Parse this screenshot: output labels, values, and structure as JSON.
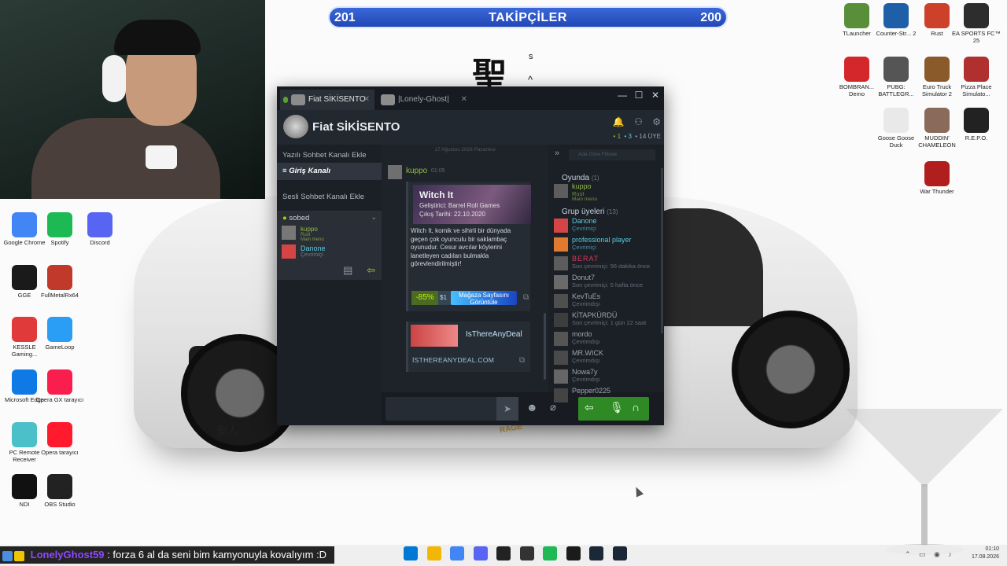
{
  "follower_bar": {
    "current": "201",
    "label": "TAKİPÇİLER",
    "goal": "200",
    "progress": 1.0
  },
  "wallpaper": {
    "kanji_main": "聖",
    "kanji_s": "s",
    "kanji_caret": "^",
    "car_kanji": "聖人",
    "car_badge": "RAGE"
  },
  "desktop_left": [
    {
      "id": "chrome",
      "label": "Google Chrome",
      "color": "#4285f4",
      "icon": "chrome-icon"
    },
    {
      "id": "spotify",
      "label": "Spotify",
      "color": "#1db954",
      "icon": "spotify-icon"
    },
    {
      "id": "discord",
      "label": "Discord",
      "color": "#5865f2",
      "icon": "discord-icon"
    },
    {
      "id": "gg",
      "label": "GGE",
      "color": "#1a1a1a",
      "icon": "power-icon"
    },
    {
      "id": "fw",
      "label": "FullMetalRx64",
      "color": "#c0392b",
      "icon": "flame-icon"
    },
    {
      "id": "kesk",
      "label": "KESSLE Gaming...",
      "color": "#e03a3a",
      "icon": "kessle-icon"
    },
    {
      "id": "gameloop",
      "label": "GameLoop",
      "color": "#2a9df4",
      "icon": "gameloop-icon"
    },
    {
      "id": "edge",
      "label": "Microsoft Edge",
      "color": "#0f7ae5",
      "icon": "edge-icon"
    },
    {
      "id": "operagx",
      "label": "Opera GX tarayıcı",
      "color": "#fa1e4e",
      "icon": "opera-gx-icon"
    },
    {
      "id": "parsec",
      "label": "PC Remote Receiver",
      "color": "#4bc0c8",
      "icon": "remote-icon"
    },
    {
      "id": "opera",
      "label": "Opera tarayıcı",
      "color": "#ff1b2d",
      "icon": "opera-icon"
    },
    {
      "id": "ndi",
      "label": "NDI",
      "color": "#111111",
      "icon": "ndi-icon"
    },
    {
      "id": "obs",
      "label": "OBS Studio",
      "color": "#222222",
      "icon": "obs-icon"
    }
  ],
  "desktop_right": [
    {
      "id": "tlauncher",
      "label": "TLauncher",
      "color": "#5a8f3a",
      "icon": "minecraft-icon"
    },
    {
      "id": "cs2",
      "label": "Counter-Str... 2",
      "color": "#1f5fa8",
      "icon": "cs-icon"
    },
    {
      "id": "rust",
      "label": "Rust",
      "color": "#cd412b",
      "icon": "rust-icon"
    },
    {
      "id": "fc25",
      "label": "EA SPORTS FC™ 25",
      "color": "#2d2d2d",
      "icon": "fc-icon"
    },
    {
      "id": "bomb",
      "label": "BOMBRAN... Demo",
      "color": "#d4272b",
      "icon": "bomb-icon"
    },
    {
      "id": "pubg",
      "label": "PUBG: BATTLEGR...",
      "color": "#555555",
      "icon": "pubg-icon"
    },
    {
      "id": "ets2",
      "label": "Euro Truck Simulator 2",
      "color": "#8b5a2b",
      "icon": "truck-icon"
    },
    {
      "id": "pizza",
      "label": "Pizza Place Simulato...",
      "color": "#b03030",
      "icon": "pizza-icon"
    },
    {
      "id": "goose",
      "label": "Goose Goose Duck",
      "color": "#e9e9e9",
      "icon": "goose-icon"
    },
    {
      "id": "muggame",
      "label": "MUDDIN' CHAMELEON",
      "color": "#8a6a5a",
      "icon": "chameleon-icon"
    },
    {
      "id": "repo",
      "label": "R.E.P.O.",
      "color": "#222222",
      "icon": "repo-icon"
    },
    {
      "id": "warthunder",
      "label": "War Thunder",
      "color": "#b01e1e",
      "icon": "war-thunder-icon"
    }
  ],
  "steam": {
    "tabs": [
      {
        "label": "Fiat SİKİSENTO",
        "active": true
      },
      {
        "label": "|Lonely-Ghost|",
        "active": false
      }
    ],
    "group_name": "Fiat SİKİSENTO",
    "counts": {
      "in_game": "1",
      "online": "3",
      "members": "14 ÜYE"
    },
    "channels": {
      "add_text": "Yazılı Sohbet Kanalı Ekle",
      "entry": "Giriş Kanalı",
      "add_voice": "Sesli Sohbet Kanalı Ekle",
      "voice_name": "sobed",
      "voice_members": [
        {
          "name": "kuppo",
          "status": "Rust",
          "sub": "Main menu",
          "state": "ingame"
        },
        {
          "name": "Danone",
          "status": "Çevrimiçi",
          "state": "online"
        }
      ]
    },
    "chat": {
      "date": "17 Ağustos 2026 Pazartesi",
      "sender": "kuppo",
      "time": "01:05",
      "game_embed": {
        "title": "Witch It",
        "developer": "Geliştirici: Barrel Roll Games",
        "release": "Çıkış Tarihi: 22.10.2020",
        "description": "Witch It, komik ve sihirli bir dünyada geçen çok oyunculu bir saklambaç oyunudur. Cesur avcılar köylerini lanetleyen cadıları bulmakla görevlendirilmiştir!",
        "discount": "-85%",
        "price": "$1",
        "store_button": "Mağaza Sayfasını Görüntüle"
      },
      "link_embed": {
        "title": "IsThereAnyDeal",
        "url": "İSTHEREANYDEAL.COM"
      }
    },
    "members": {
      "search_placeholder": "Ada Göre Filtrele",
      "in_game_header": "Oyunda",
      "in_game_count": "(1)",
      "group_header": "Grup üyeleri",
      "group_count": "(13)",
      "in_game": [
        {
          "name": "kuppo",
          "status": "Rust",
          "sub": "Main menu"
        }
      ],
      "group": [
        {
          "name": "Danone",
          "status": "Çevrimiçi",
          "state": "online"
        },
        {
          "name": "professional player",
          "status": "Çevrimiçi",
          "state": "online"
        },
        {
          "name": "BERAT",
          "status": "Son çevrimiçi: 56 dakika önce",
          "state": "pink"
        },
        {
          "name": "Donut7",
          "status": "Son çevrimiçi: 5 hafta önce",
          "state": "offline"
        },
        {
          "name": "KevTuEs",
          "status": "Çevrimdışı",
          "state": "offline"
        },
        {
          "name": "KİTAPKÜRDÜ",
          "status": "Son çevrimiçi: 1 gün 22 saat",
          "state": "offline"
        },
        {
          "name": "mordo",
          "status": "Çevrimdışı",
          "state": "offline"
        },
        {
          "name": "MR.WICK",
          "status": "Çevrimdışı",
          "state": "offline"
        },
        {
          "name": "Nowa7y",
          "status": "Çevrimdışı",
          "state": "offline"
        },
        {
          "name": "Pepper0225",
          "status": "",
          "state": "offline"
        }
      ]
    }
  },
  "stream_chat": {
    "user": "LonelyGhost59",
    "message": ": forza 6 al da seni bim kamyonuyla kovalıyım :D"
  },
  "taskbar": {
    "time": "01:10",
    "date": "17.08.2026",
    "apps": [
      {
        "icon": "windows-start-icon",
        "color": "#0078d4"
      },
      {
        "icon": "file-explorer-icon",
        "color": "#f2b705"
      },
      {
        "icon": "chrome-icon",
        "color": "#4285f4"
      },
      {
        "icon": "discord-icon",
        "color": "#5865f2"
      },
      {
        "icon": "obs-icon",
        "color": "#222222"
      },
      {
        "icon": "obs-icon-2",
        "color": "#333333"
      },
      {
        "icon": "spotify-icon",
        "color": "#1db954"
      },
      {
        "icon": "epic-games-icon",
        "color": "#1b1b1b"
      },
      {
        "icon": "steam-icon",
        "color": "#1b2838"
      },
      {
        "icon": "steam-icon-2",
        "color": "#1b2838"
      }
    ]
  }
}
